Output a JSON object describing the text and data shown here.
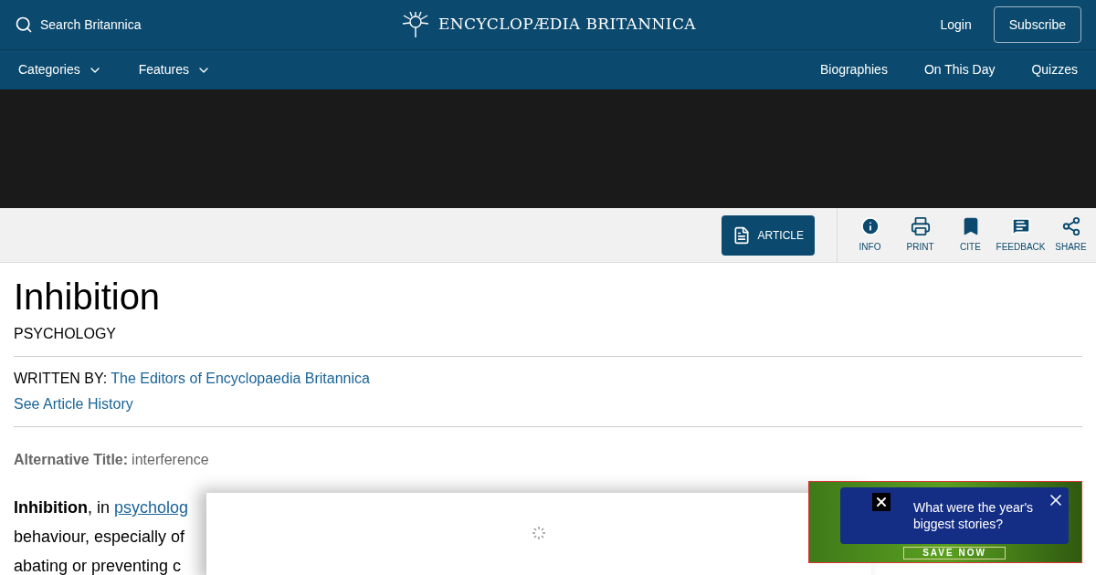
{
  "header": {
    "search_placeholder": "Search Britannica",
    "logo": "ENCYCLOPÆDIA BRITANNICA",
    "login": "Login",
    "subscribe": "Subscribe"
  },
  "nav": {
    "menus": [
      {
        "label": "Categories"
      },
      {
        "label": "Features"
      }
    ],
    "links": [
      "Biographies",
      "On This Day",
      "Quizzes"
    ]
  },
  "toolbar": {
    "article": {
      "label": "ARTICLE",
      "selected": true
    },
    "actions": [
      {
        "kind": "info",
        "label": "INFO"
      },
      {
        "kind": "print",
        "label": "PRINT"
      },
      {
        "kind": "cite",
        "label": "CITE"
      },
      {
        "kind": "feedback",
        "label": "FEEDBACK"
      },
      {
        "kind": "share",
        "label": "SHARE"
      }
    ]
  },
  "article": {
    "title": "Inhibition",
    "topic": "PSYCHOLOGY",
    "written_by_label": "WRITTEN BY:",
    "author": "The Editors of Encyclopaedia Britannica",
    "history_link": "See Article History",
    "alt_title_label": "Alternative Title:",
    "alt_title": "interference",
    "lines": [
      {
        "lead": "Inhibition",
        "text": ", in ",
        "link": "psycholog"
      },
      {
        "text": "behaviour, especially of"
      },
      {
        "text": "abating or preventing c"
      }
    ]
  },
  "ad": {
    "button": "SAVE NOW"
  },
  "toast": {
    "text": "What were the year's biggest stories?"
  }
}
